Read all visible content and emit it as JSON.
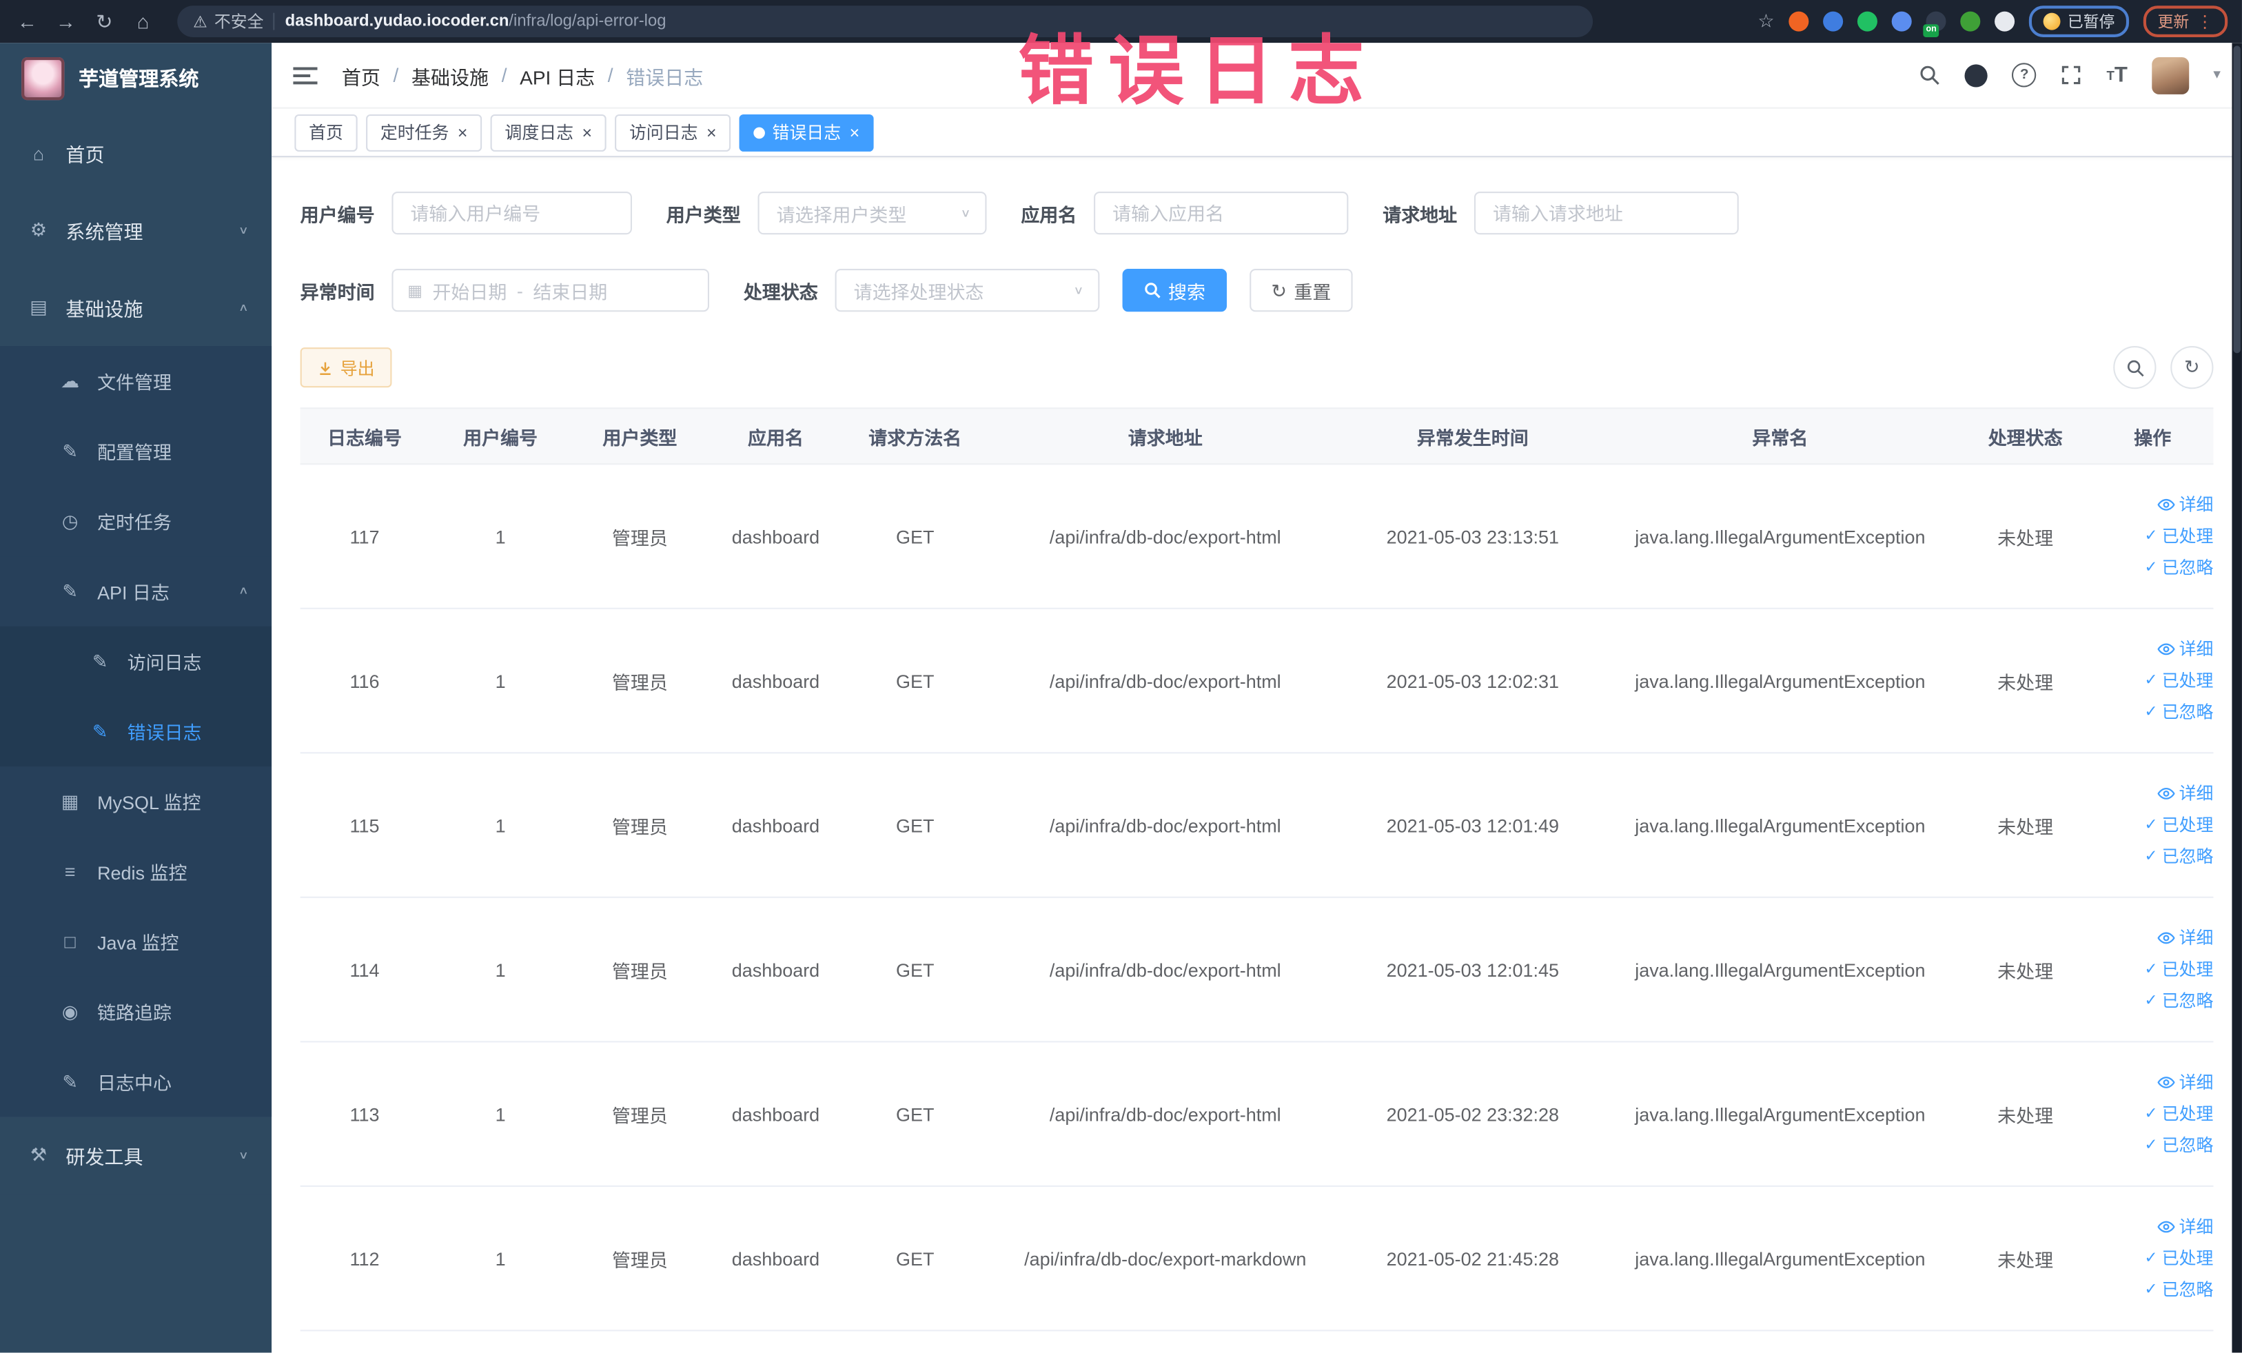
{
  "colors": {
    "accent": "#409eff",
    "warning": "#e6a23c",
    "annotation_pink": "#f24870",
    "sidebar_bg": "#2e4960",
    "browser_bar_bg": "#1c2431"
  },
  "annotation": {
    "text": "错误日志"
  },
  "browser": {
    "security_label": "不安全",
    "url_domain": "dashboard.yudao.iocoder.cn",
    "url_path": "/infra/log/api-error-log",
    "extensions": [
      {
        "name": "extension-orange-icon",
        "color": "#f06423"
      },
      {
        "name": "extension-shield-icon",
        "color": "#3f7de0"
      },
      {
        "name": "extension-green-circle-icon",
        "color": "#21c063"
      },
      {
        "name": "extension-grid-icon",
        "color": "#5b8def"
      },
      {
        "name": "extension-on-badge-icon",
        "color": "#323c4e",
        "badge": "on"
      },
      {
        "name": "extension-plant-icon",
        "color": "#3fa037"
      },
      {
        "name": "extensions-puzzle-icon",
        "color": "#e7eaef"
      }
    ],
    "paused_badge": {
      "label": "已暂停"
    },
    "update_badge": {
      "label": "更新"
    }
  },
  "sidebar": {
    "app_title": "芋道管理系统",
    "items": [
      {
        "label": "首页",
        "icon": "home-icon",
        "depth": 0
      },
      {
        "label": "系统管理",
        "icon": "gear-icon",
        "depth": 0,
        "chevron": "down"
      },
      {
        "label": "基础设施",
        "icon": "monitor-icon",
        "depth": 0,
        "chevron": "up"
      },
      {
        "label": "文件管理",
        "icon": "cloud-upload-icon",
        "depth": 1
      },
      {
        "label": "配置管理",
        "icon": "config-edit-icon",
        "depth": 1
      },
      {
        "label": "定时任务",
        "icon": "schedule-icon",
        "depth": 1
      },
      {
        "label": "API 日志",
        "icon": "api-log-icon",
        "depth": 1,
        "chevron": "up"
      },
      {
        "label": "访问日志",
        "icon": "access-log-icon",
        "depth": 2
      },
      {
        "label": "错误日志",
        "icon": "error-log-icon",
        "depth": 2,
        "active": true
      },
      {
        "label": "MySQL 监控",
        "icon": "mysql-icon",
        "depth": 1
      },
      {
        "label": "Redis 监控",
        "icon": "redis-icon",
        "depth": 1
      },
      {
        "label": "Java 监控",
        "icon": "java-icon",
        "depth": 1
      },
      {
        "label": "链路追踪",
        "icon": "trace-icon",
        "depth": 1
      },
      {
        "label": "日志中心",
        "icon": "log-center-icon",
        "depth": 1
      },
      {
        "label": "研发工具",
        "icon": "tools-icon",
        "depth": 0,
        "chevron": "down"
      }
    ]
  },
  "header": {
    "breadcrumb": [
      "首页",
      "基础设施",
      "API 日志",
      "错误日志"
    ]
  },
  "tabs": [
    {
      "label": "首页",
      "closable": false,
      "active": false
    },
    {
      "label": "定时任务",
      "closable": true,
      "active": false
    },
    {
      "label": "调度日志",
      "closable": true,
      "active": false
    },
    {
      "label": "访问日志",
      "closable": true,
      "active": false
    },
    {
      "label": "错误日志",
      "closable": true,
      "active": true
    }
  ],
  "filters": {
    "row1": [
      {
        "label": "用户编号",
        "placeholder": "请输入用户编号",
        "type": "input"
      },
      {
        "label": "用户类型",
        "placeholder": "请选择用户类型",
        "type": "select"
      },
      {
        "label": "应用名",
        "placeholder": "请输入应用名",
        "type": "input"
      },
      {
        "label": "请求地址",
        "placeholder": "请输入请求地址",
        "type": "input"
      }
    ],
    "row2": {
      "date_label": "异常时间",
      "date_start_placeholder": "开始日期",
      "date_separator": "-",
      "date_end_placeholder": "结束日期",
      "status_label": "处理状态",
      "status_placeholder": "请选择处理状态",
      "search_label": "搜索",
      "reset_label": "重置"
    }
  },
  "toolbar": {
    "export_label": "导出"
  },
  "table": {
    "columns": [
      "日志编号",
      "用户编号",
      "用户类型",
      "应用名",
      "请求方法名",
      "请求地址",
      "异常发生时间",
      "异常名",
      "处理状态",
      "操作"
    ],
    "actions": [
      "详细",
      "已处理",
      "已忽略"
    ],
    "rows": [
      {
        "id": "117",
        "user_id": "1",
        "user_type": "管理员",
        "app": "dashboard",
        "method": "GET",
        "url": "/api/infra/db-doc/export-html",
        "time": "2021-05-03 23:13:51",
        "exception": "java.lang.IllegalArgumentException",
        "status": "未处理"
      },
      {
        "id": "116",
        "user_id": "1",
        "user_type": "管理员",
        "app": "dashboard",
        "method": "GET",
        "url": "/api/infra/db-doc/export-html",
        "time": "2021-05-03 12:02:31",
        "exception": "java.lang.IllegalArgumentException",
        "status": "未处理"
      },
      {
        "id": "115",
        "user_id": "1",
        "user_type": "管理员",
        "app": "dashboard",
        "method": "GET",
        "url": "/api/infra/db-doc/export-html",
        "time": "2021-05-03 12:01:49",
        "exception": "java.lang.IllegalArgumentException",
        "status": "未处理"
      },
      {
        "id": "114",
        "user_id": "1",
        "user_type": "管理员",
        "app": "dashboard",
        "method": "GET",
        "url": "/api/infra/db-doc/export-html",
        "time": "2021-05-03 12:01:45",
        "exception": "java.lang.IllegalArgumentException",
        "status": "未处理"
      },
      {
        "id": "113",
        "user_id": "1",
        "user_type": "管理员",
        "app": "dashboard",
        "method": "GET",
        "url": "/api/infra/db-doc/export-html",
        "time": "2021-05-02 23:32:28",
        "exception": "java.lang.IllegalArgumentException",
        "status": "未处理"
      },
      {
        "id": "112",
        "user_id": "1",
        "user_type": "管理员",
        "app": "dashboard",
        "method": "GET",
        "url": "/api/infra/db-doc/export-markdown",
        "time": "2021-05-02 21:45:28",
        "exception": "java.lang.IllegalArgumentException",
        "status": "未处理"
      }
    ]
  }
}
